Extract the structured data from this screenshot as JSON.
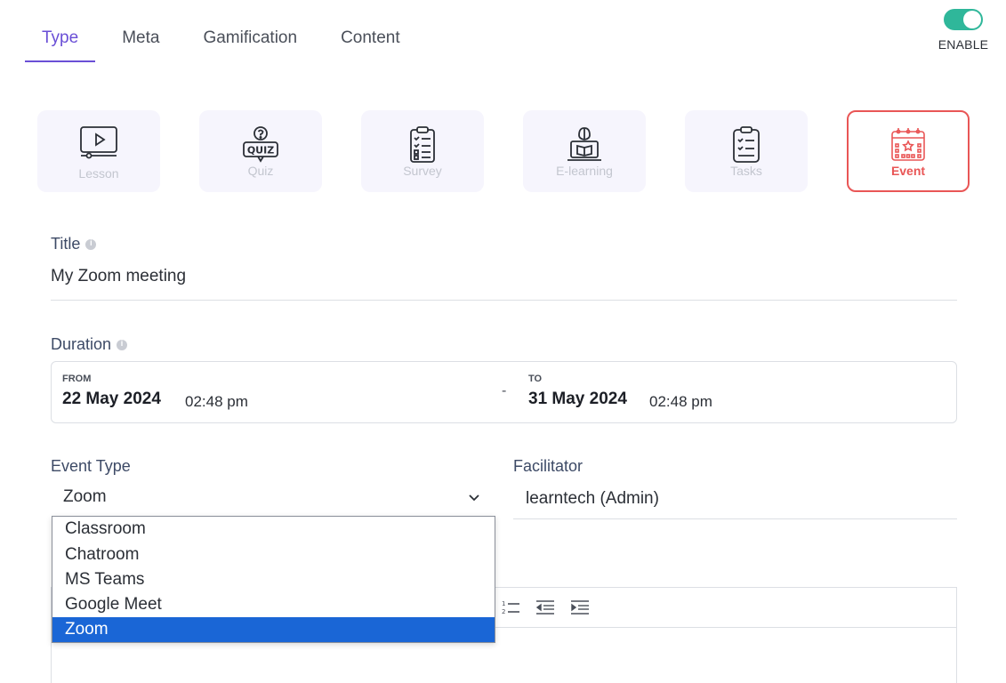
{
  "tabs": [
    {
      "label": "Type",
      "active": true
    },
    {
      "label": "Meta"
    },
    {
      "label": "Gamification"
    },
    {
      "label": "Content"
    }
  ],
  "toggle": {
    "label": "ENABLE",
    "on": true,
    "color": "#2fb79a"
  },
  "types": [
    {
      "label": "Lesson",
      "icon": "video-lesson-icon"
    },
    {
      "label": "Quiz",
      "icon": "quiz-icon"
    },
    {
      "label": "Survey",
      "icon": "survey-clipboard-icon"
    },
    {
      "label": "E-learning",
      "icon": "e-learning-icon"
    },
    {
      "label": "Tasks",
      "icon": "tasks-clipboard-icon"
    },
    {
      "label": "Event",
      "icon": "calendar-event-icon",
      "selected": true
    }
  ],
  "title": {
    "label": "Title",
    "value": "My Zoom meeting"
  },
  "duration": {
    "label": "Duration",
    "from_caption": "FROM",
    "from_date": "22 May 2024",
    "from_time": "02:48 pm",
    "separator": "-",
    "to_caption": "TO",
    "to_date": "31 May 2024",
    "to_time": "02:48 pm"
  },
  "event_type": {
    "label": "Event Type",
    "value": "Zoom",
    "options": [
      "Classroom",
      "Chatroom",
      "MS Teams",
      "Google Meet",
      "Zoom"
    ],
    "selected_index": 4
  },
  "facilitator": {
    "label": "Facilitator",
    "value": "learntech (Admin)"
  },
  "colors": {
    "accent": "#6a4fd6",
    "selected_card": "#e95656",
    "option_highlight": "#1a66d6"
  }
}
